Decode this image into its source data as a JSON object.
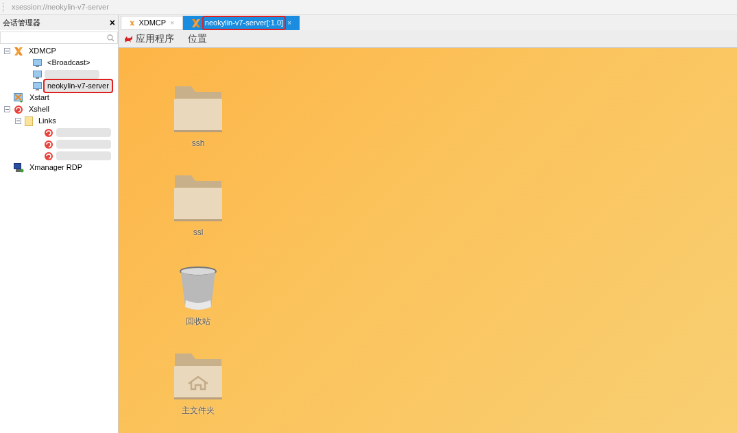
{
  "address_bar": {
    "value": "xsession://neokylin-v7-server"
  },
  "sidebar": {
    "title": "会话管理器",
    "close": "×",
    "tree": [
      {
        "label": "XDMCP",
        "kind": "xdmcp",
        "expanded": true,
        "children": [
          {
            "label": "<Broadcast>",
            "kind": "monitor",
            "selected": false
          },
          {
            "kind": "redacted",
            "selected": false
          },
          {
            "label": "neokylin-v7-server",
            "kind": "monitor",
            "annotated": true,
            "selected": true
          }
        ]
      },
      {
        "label": "Xstart",
        "kind": "xstart"
      },
      {
        "label": "Xshell",
        "kind": "xshell",
        "expanded": true,
        "children": [
          {
            "label": "Links",
            "kind": "folder",
            "expanded": true,
            "children": [
              {
                "kind": "redacted-shell"
              },
              {
                "kind": "redacted-shell"
              },
              {
                "kind": "redacted-shell"
              }
            ]
          }
        ]
      },
      {
        "label": "Xmanager RDP",
        "kind": "rdp"
      }
    ]
  },
  "tabs": [
    {
      "label": "XDMCP",
      "selected": false,
      "close": "×"
    },
    {
      "label": "neokylin-v7-server[:1.0]",
      "selected": true,
      "annotated": true,
      "close": "×"
    }
  ],
  "menu": [
    {
      "label": "应用程序"
    },
    {
      "label": "位置"
    }
  ],
  "desktop_icons": [
    {
      "label": "ssh",
      "kind": "folder"
    },
    {
      "label": "ssl",
      "kind": "folder"
    },
    {
      "label": "回收站",
      "kind": "trash"
    },
    {
      "label": "主文件夹",
      "kind": "home"
    }
  ]
}
